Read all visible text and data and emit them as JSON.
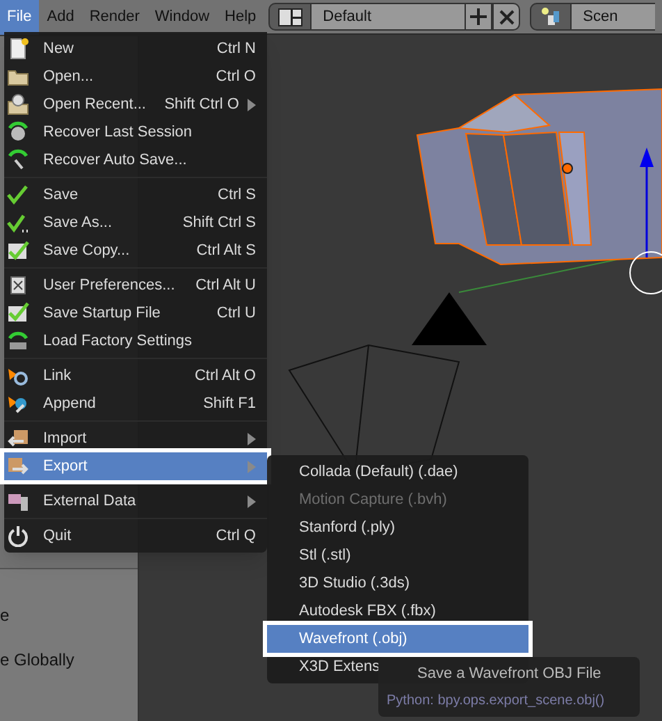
{
  "header": {
    "menus": [
      {
        "label": "File",
        "selected": true
      },
      {
        "label": "Add",
        "selected": false
      },
      {
        "label": "Render",
        "selected": false
      },
      {
        "label": "Window",
        "selected": false
      },
      {
        "label": "Help",
        "selected": false
      }
    ],
    "layout": "Default",
    "scene": "Scen"
  },
  "left_panel": {
    "lines": [
      "e",
      "e Globally"
    ]
  },
  "file_menu": {
    "groups": [
      [
        {
          "label": "New",
          "shortcut": "Ctrl N",
          "submenu": false,
          "selected": false
        },
        {
          "label": "Open...",
          "shortcut": "Ctrl O",
          "submenu": false,
          "selected": false
        },
        {
          "label": "Open Recent...",
          "shortcut": "Shift Ctrl O",
          "submenu": true,
          "selected": false
        },
        {
          "label": "Recover Last Session",
          "submenu": false,
          "selected": false
        },
        {
          "label": "Recover Auto Save...",
          "submenu": false,
          "selected": false
        }
      ],
      [
        {
          "label": "Save",
          "shortcut": "Ctrl S",
          "submenu": false,
          "selected": false
        },
        {
          "label": "Save As...",
          "shortcut": "Shift Ctrl S",
          "submenu": false,
          "selected": false
        },
        {
          "label": "Save Copy...",
          "shortcut": "Ctrl Alt S",
          "submenu": false,
          "selected": false
        }
      ],
      [
        {
          "label": "User Preferences...",
          "shortcut": "Ctrl Alt U",
          "submenu": false,
          "selected": false
        },
        {
          "label": "Save Startup File",
          "shortcut": "Ctrl U",
          "submenu": false,
          "selected": false
        },
        {
          "label": "Load Factory Settings",
          "submenu": false,
          "selected": false
        }
      ],
      [
        {
          "label": "Link",
          "shortcut": "Ctrl Alt O",
          "submenu": false,
          "selected": false
        },
        {
          "label": "Append",
          "shortcut": "Shift F1",
          "submenu": false,
          "selected": false
        }
      ],
      [
        {
          "label": "Import",
          "submenu": true,
          "selected": false
        },
        {
          "label": "Export",
          "submenu": true,
          "selected": true
        }
      ],
      [
        {
          "label": "External Data",
          "submenu": true,
          "selected": false
        }
      ],
      [
        {
          "label": "Quit",
          "shortcut": "Ctrl Q",
          "submenu": false,
          "selected": false
        }
      ]
    ]
  },
  "export_menu": {
    "items": [
      {
        "label": "Collada (Default) (.dae)",
        "disabled": false,
        "selected": false
      },
      {
        "label": "Motion Capture (.bvh)",
        "disabled": true,
        "selected": false
      },
      {
        "label": "Stanford (.ply)",
        "disabled": false,
        "selected": false
      },
      {
        "label": "Stl (.stl)",
        "disabled": false,
        "selected": false
      },
      {
        "label": "3D Studio (.3ds)",
        "disabled": false,
        "selected": false
      },
      {
        "label": "Autodesk FBX (.fbx)",
        "disabled": false,
        "selected": false
      },
      {
        "label": "Wavefront (.obj)",
        "disabled": false,
        "selected": true
      },
      {
        "label": "X3D Extens",
        "disabled": false,
        "selected": false
      }
    ]
  },
  "tooltip": {
    "title": "Save a Wavefront OBJ File",
    "python": "Python: bpy.ops.export_scene.obj()"
  }
}
